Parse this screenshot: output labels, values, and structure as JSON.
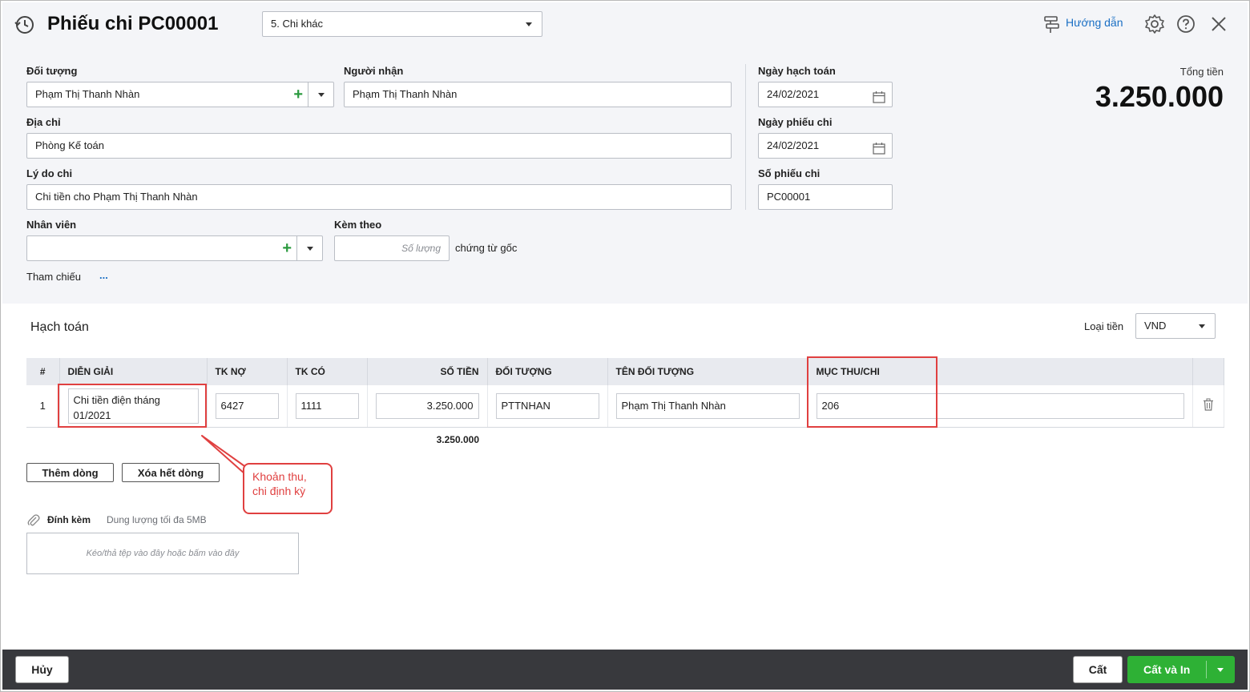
{
  "header": {
    "title": "Phiếu chi PC00001",
    "type_select": "5. Chi khác",
    "help_label": "Hướng dẫn"
  },
  "form": {
    "doi_tuong": {
      "label": "Đối tượng",
      "value": "Phạm Thị Thanh Nhàn"
    },
    "nguoi_nhan": {
      "label": "Người nhận",
      "value": "Phạm Thị Thanh Nhàn"
    },
    "dia_chi": {
      "label": "Địa chỉ",
      "value": "Phòng Kế toán"
    },
    "ly_do": {
      "label": "Lý do chi",
      "value": "Chi tiền cho Phạm Thị Thanh Nhàn"
    },
    "nhan_vien": {
      "label": "Nhân viên",
      "value": ""
    },
    "kem_theo": {
      "label": "Kèm theo",
      "placeholder": "Số lượng",
      "suffix": "chứng từ gốc"
    },
    "tham_chieu": {
      "label": "Tham chiếu",
      "link": "..."
    },
    "ngay_hach_toan": {
      "label": "Ngày hạch toán",
      "value": "24/02/2021"
    },
    "ngay_phieu_chi": {
      "label": "Ngày phiếu chi",
      "value": "24/02/2021"
    },
    "so_phieu_chi": {
      "label": "Số phiếu chi",
      "value": "PC00001"
    },
    "tong_tien": {
      "label": "Tổng tiền",
      "value": "3.250.000"
    }
  },
  "hach_toan": {
    "title": "Hạch toán",
    "currency_label": "Loại tiền",
    "currency_value": "VND",
    "columns": [
      "#",
      "DIỄN GIẢI",
      "TK NỢ",
      "TK CÓ",
      "SỐ TIỀN",
      "ĐỐI TƯỢNG",
      "TÊN ĐỐI TƯỢNG",
      "MỤC THU/CHI"
    ],
    "rows": [
      {
        "no": "1",
        "dien_giai": "Chi tiền điện tháng 01/2021",
        "tk_no": "6427",
        "tk_co": "1111",
        "so_tien": "3.250.000",
        "doi_tuong": "PTTNHAN",
        "ten_doi_tuong": "Phạm Thị Thanh Nhàn",
        "muc_thu_chi": "206"
      }
    ],
    "sum": "3.250.000",
    "add_row": "Thêm dòng",
    "clear_rows": "Xóa hết dòng"
  },
  "callout": {
    "text": "Khoản thu, chi định kỳ",
    "color": "#e04040"
  },
  "attach": {
    "label": "Đính kèm",
    "hint": "Dung lượng tối đa 5MB",
    "drop_text": "Kéo/thả tệp vào đây hoặc bấm vào đây"
  },
  "footer": {
    "cancel": "Hủy",
    "save": "Cất",
    "save_print": "Cất và In",
    "accent": "#2eb135"
  }
}
